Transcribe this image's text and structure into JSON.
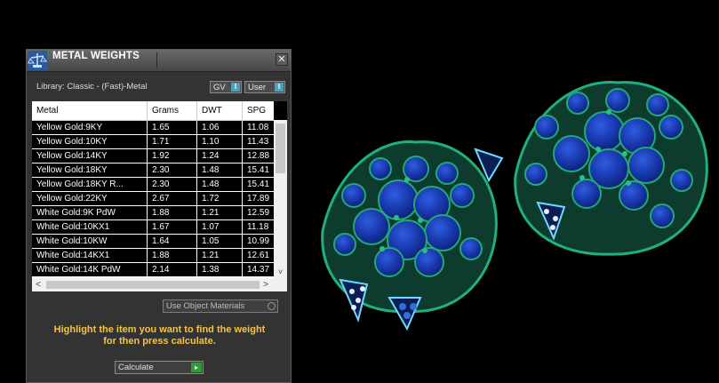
{
  "window": {
    "title": "METAL WEIGHTS",
    "close_glyph": "✕"
  },
  "library_label": "Library: Classic - (Fast)-Metal",
  "dropdowns": {
    "gv_label": "GV",
    "user_label": "User",
    "button_glyph": "I"
  },
  "table": {
    "columns": [
      "Metal",
      "Grams",
      "DWT",
      "SPG"
    ],
    "rows": [
      [
        "Yellow Gold:9KY",
        "1.65",
        "1.06",
        "11.08"
      ],
      [
        "Yellow Gold:10KY",
        "1.71",
        "1.10",
        "11.43"
      ],
      [
        "Yellow Gold:14KY",
        "1.92",
        "1.24",
        "12.88"
      ],
      [
        "Yellow Gold:18KY",
        "2.30",
        "1.48",
        "15.41"
      ],
      [
        "Yellow Gold:18KY R...",
        "2.30",
        "1.48",
        "15.41"
      ],
      [
        "Yellow Gold:22KY",
        "2.67",
        "1.72",
        "17.89"
      ],
      [
        "White Gold:9K PdW",
        "1.88",
        "1.21",
        "12.59"
      ],
      [
        "White Gold:10KX1",
        "1.67",
        "1.07",
        "11.18"
      ],
      [
        "White Gold:10KW",
        "1.64",
        "1.05",
        "10.99"
      ],
      [
        "White Gold:14KX1",
        "1.88",
        "1.21",
        "12.61"
      ],
      [
        "White Gold:14K PdW",
        "2.14",
        "1.38",
        "14.37"
      ]
    ],
    "scroll_up": "▲",
    "scroll_down": "˅",
    "scroll_left": "<",
    "scroll_right": ">"
  },
  "use_object_materials": "Use Object Materials",
  "hint_line1": "Highlight the item you want to find the weight",
  "hint_line2": "for then press calculate.",
  "calculate_label": "Calculate",
  "calculate_glyph": "▸",
  "colors": {
    "accent_yellow": "#f5c542",
    "gem_blue": "#1a3fb8",
    "metal_green": "#1f9a6a",
    "pave_white": "#e8f2ff"
  }
}
